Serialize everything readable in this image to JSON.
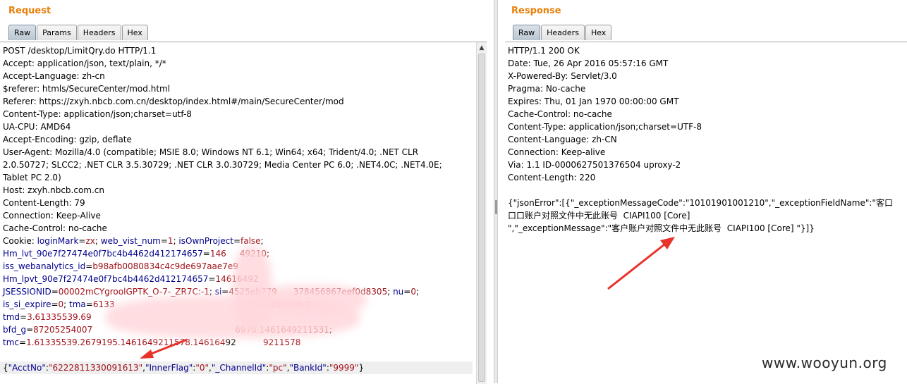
{
  "request": {
    "title": "Request",
    "tabs": [
      "Raw",
      "Params",
      "Headers",
      "Hex"
    ],
    "active_tab": "Raw",
    "lines": [
      [
        {
          "t": "POST /desktop/LimitQry.do HTTP/1.1",
          "c": "p"
        }
      ],
      [
        {
          "t": "Accept: application/json, text/plain, */*",
          "c": "p"
        }
      ],
      [
        {
          "t": "Accept-Language: zh-cn",
          "c": "p"
        }
      ],
      [
        {
          "t": "$referer: htmls/SecureCenter/mod.html",
          "c": "p"
        }
      ],
      [
        {
          "t": "Referer: https://zxyh.nbcb.com.cn/desktop/index.html#/main/SecureCenter/mod",
          "c": "p"
        }
      ],
      [
        {
          "t": "Content-Type: application/json;charset=utf-8",
          "c": "p"
        }
      ],
      [
        {
          "t": "UA-CPU: AMD64",
          "c": "p"
        }
      ],
      [
        {
          "t": "Accept-Encoding: gzip, deflate",
          "c": "p"
        }
      ],
      [
        {
          "t": "User-Agent: Mozilla/4.0 (compatible; MSIE 8.0; Windows NT 6.1; Win64; x64; Trident/4.0; .NET CLR",
          "c": "p"
        }
      ],
      [
        {
          "t": "2.0.50727; SLCC2; .NET CLR 3.5.30729; .NET CLR 3.0.30729; Media Center PC 6.0; .NET4.0C; .NET4.0E;",
          "c": "p"
        }
      ],
      [
        {
          "t": "Tablet PC 2.0)",
          "c": "p"
        }
      ],
      [
        {
          "t": "Host: zxyh.nbcb.com.cn",
          "c": "p"
        }
      ],
      [
        {
          "t": "Content-Length: 79",
          "c": "p"
        }
      ],
      [
        {
          "t": "Connection: Keep-Alive",
          "c": "p"
        }
      ],
      [
        {
          "t": "Cache-Control: no-cache",
          "c": "p"
        }
      ],
      [
        {
          "t": "Cookie: ",
          "c": "p"
        },
        {
          "t": "loginMark",
          "c": "k"
        },
        {
          "t": "=",
          "c": "p"
        },
        {
          "t": "zx",
          "c": "v"
        },
        {
          "t": "; ",
          "c": "p"
        },
        {
          "t": "web_vist_num",
          "c": "k"
        },
        {
          "t": "=",
          "c": "p"
        },
        {
          "t": "1",
          "c": "v"
        },
        {
          "t": "; ",
          "c": "p"
        },
        {
          "t": "isOwnProject",
          "c": "k"
        },
        {
          "t": "=",
          "c": "p"
        },
        {
          "t": "false",
          "c": "v"
        },
        {
          "t": ";",
          "c": "p"
        }
      ],
      [
        {
          "t": "Hm_lvt_90e7f27474e0f7bc4b4462d412174657",
          "c": "k"
        },
        {
          "t": "=",
          "c": "p"
        },
        {
          "t": "146",
          "c": "v"
        },
        {
          "t": "     ",
          "c": "p"
        },
        {
          "t": "49210",
          "c": "v"
        },
        {
          "t": ";",
          "c": "p"
        }
      ],
      [
        {
          "t": "iss_webanalytics_id",
          "c": "k"
        },
        {
          "t": "=",
          "c": "p"
        },
        {
          "t": "b98afb0080834c4c9de697aae7e9",
          "c": "v"
        }
      ],
      [
        {
          "t": "Hm_lpvt_90e7f27474e0f7bc4b4462d412174657",
          "c": "k"
        },
        {
          "t": "=",
          "c": "p"
        },
        {
          "t": "14616492",
          "c": "v"
        }
      ],
      [
        {
          "t": "JSESSIONID",
          "c": "k"
        },
        {
          "t": "=",
          "c": "p"
        },
        {
          "t": "00002mCYgroolGPTK_O-7-_ZR7C:-1",
          "c": "v"
        },
        {
          "t": "; ",
          "c": "p"
        },
        {
          "t": "si",
          "c": "k"
        },
        {
          "t": "=",
          "c": "p"
        },
        {
          "t": "4525eb779",
          "c": "v"
        },
        {
          "t": "      ",
          "c": "p"
        },
        {
          "t": "378456867eef0d8305",
          "c": "v"
        },
        {
          "t": "; ",
          "c": "p"
        },
        {
          "t": "nu",
          "c": "k"
        },
        {
          "t": "=",
          "c": "p"
        },
        {
          "t": "0",
          "c": "v"
        },
        {
          "t": ";",
          "c": "p"
        }
      ],
      [
        {
          "t": "is_si_expire",
          "c": "k"
        },
        {
          "t": "=",
          "c": "p"
        },
        {
          "t": "0",
          "c": "v"
        },
        {
          "t": "; ",
          "c": "p"
        },
        {
          "t": "tma",
          "c": "k"
        },
        {
          "t": "=",
          "c": "p"
        },
        {
          "t": "6133",
          "c": "v"
        },
        {
          "t": "                                                  ",
          "c": "p"
        },
        {
          "t": "1649211606.2",
          "c": "v"
        },
        {
          "t": ";",
          "c": "p"
        }
      ],
      [
        {
          "t": "tmd",
          "c": "k"
        },
        {
          "t": "=",
          "c": "p"
        },
        {
          "t": "3.61335539.69",
          "c": "v"
        }
      ],
      [
        {
          "t": "bfd_g",
          "c": "k"
        },
        {
          "t": "=",
          "c": "p"
        },
        {
          "t": "87205254007",
          "c": "v"
        },
        {
          "t": "                                                     ",
          "c": "p"
        },
        {
          "t": "6978.1461649211531",
          "c": "v"
        },
        {
          "t": ";",
          "c": "p"
        }
      ],
      [
        {
          "t": "tmc",
          "c": "k"
        },
        {
          "t": "=",
          "c": "p"
        },
        {
          "t": "1.61335539.2679195.1461649211578.146164",
          "c": "v"
        },
        {
          "t": "92          ",
          "c": "p"
        },
        {
          "t": "9211578",
          "c": "v"
        }
      ]
    ],
    "body": [
      {
        "t": "{",
        "c": "p"
      },
      {
        "t": "\"AcctNo\"",
        "c": "k"
      },
      {
        "t": ":",
        "c": "p"
      },
      {
        "t": "\"6222811330091613\"",
        "c": "v"
      },
      {
        "t": ",",
        "c": "p"
      },
      {
        "t": "\"InnerFlag\"",
        "c": "k"
      },
      {
        "t": ":",
        "c": "p"
      },
      {
        "t": "\"0\"",
        "c": "v"
      },
      {
        "t": ",",
        "c": "p"
      },
      {
        "t": "\"_ChannelId\"",
        "c": "k"
      },
      {
        "t": ":",
        "c": "p"
      },
      {
        "t": "\"pc\"",
        "c": "v"
      },
      {
        "t": ",",
        "c": "p"
      },
      {
        "t": "\"BankId\"",
        "c": "k"
      },
      {
        "t": ":",
        "c": "p"
      },
      {
        "t": "\"9999\"",
        "c": "v"
      },
      {
        "t": "}",
        "c": "p"
      }
    ]
  },
  "response": {
    "title": "Response",
    "tabs": [
      "Raw",
      "Headers",
      "Hex"
    ],
    "active_tab": "Raw",
    "lines": [
      "HTTP/1.1 200 OK",
      "Date: Tue, 26 Apr 2016 05:57:16 GMT",
      "X-Powered-By: Servlet/3.0",
      "Pragma: No-cache",
      "Expires: Thu, 01 Jan 1970 00:00:00 GMT",
      "Cache-Control: no-cache",
      "Content-Type: application/json;charset=UTF-8",
      "Content-Language: zh-CN",
      "Connection: Keep-alive",
      "Via: 1.1 ID-0000627501376504 uproxy-2",
      "Content-Length: 220",
      "",
      "{\"jsonError\":[{\"_exceptionMessageCode\":\"10101901001210\",\"_exceptionFieldName\":\"客口",
      "口口账户对照文件中无此账号  CIAPI100 [Core]",
      "\",\"_exceptionMessage\":\"客户账户对照文件中无此账号  CIAPI100 [Core] \"}]}"
    ]
  },
  "watermark": "www.wooyun.org",
  "colors": {
    "accent": "#e8800a",
    "key": "#00008b",
    "value": "#a0111a",
    "arrow": "#e8322a"
  }
}
